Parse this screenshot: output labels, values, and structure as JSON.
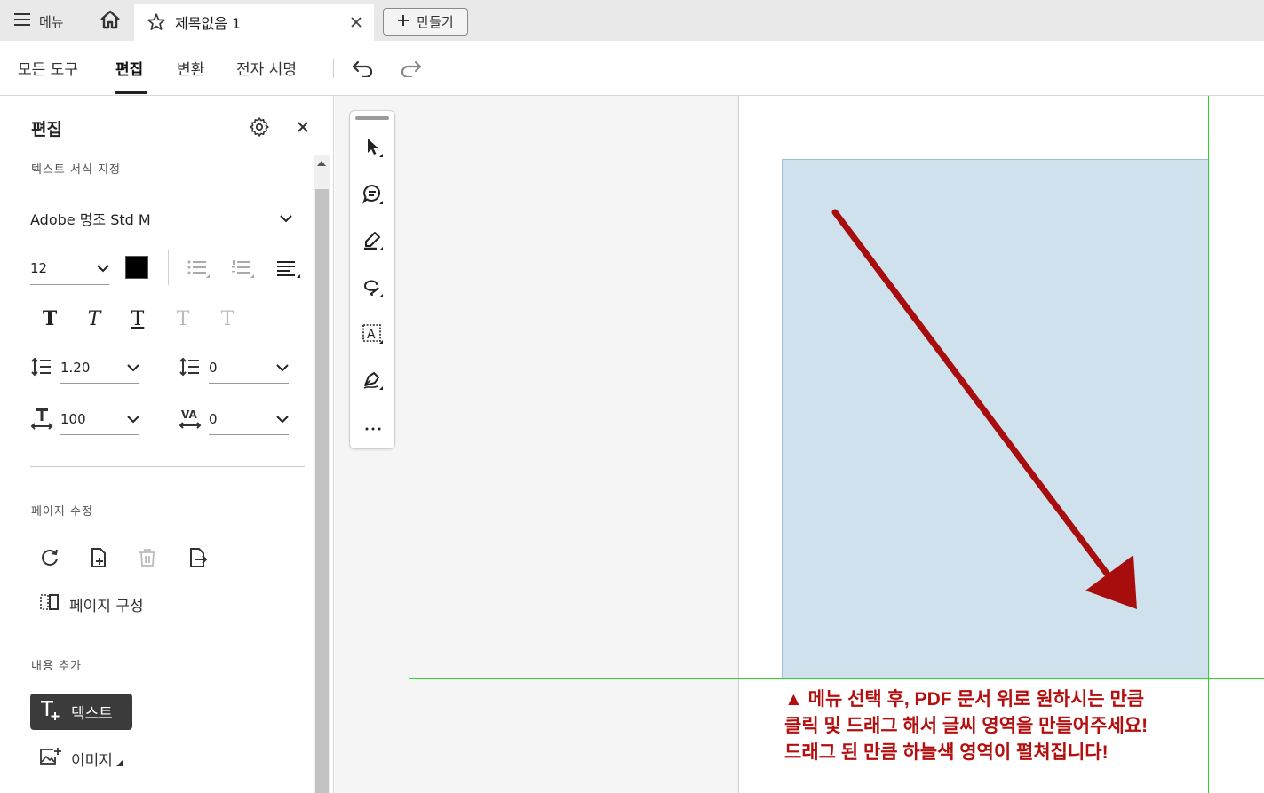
{
  "tabbar": {
    "menu_label": "메뉴",
    "doc_tab_title": "제목없음 1",
    "create_label": "만들기"
  },
  "toolbar": {
    "items": [
      "모든 도구",
      "편집",
      "변환",
      "전자 서명"
    ],
    "active": "편집"
  },
  "panel": {
    "title": "편집",
    "text_format_label": "텍스트 서식 지정",
    "font_name": "Adobe 명조 Std M",
    "font_size": "12",
    "text_color": "#000000",
    "line_spacing": "1.20",
    "paragraph_spacing": "0",
    "horizontal_scale": "100",
    "char_spacing": "0",
    "text_styles": [
      "T",
      "T",
      "T",
      "T",
      "T"
    ],
    "page_edit_label": "페이지 수정",
    "page_compose_label": "페이지 구성",
    "add_content_label": "내용 추가",
    "text_button_label": "텍스트",
    "image_button_label": "이미지"
  },
  "canvas": {
    "selection_color": "#cfe1ec",
    "guide_color": "#2bd62b",
    "annotation_color": "#b30f0f"
  },
  "note": {
    "line1": "▲ 메뉴 선택 후, PDF 문서 위로 원하시는 만큼",
    "line2": "클릭 및 드래그 해서 글씨 영역을 만들어주세요!",
    "line3": "드래그 된 만큼 하늘색 영역이 펼쳐집니다!"
  }
}
